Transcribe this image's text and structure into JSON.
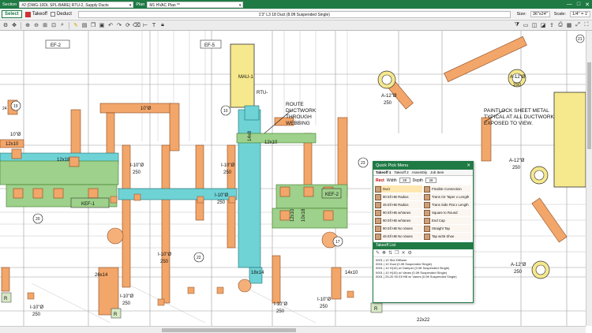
{
  "titlebar": {
    "section_label": "Section",
    "section_value": "#2 (DWG-10DL SPL-BARE) RTU-2, Supply Ducts",
    "plan_label": "Plan",
    "plan_value": "M1   HVAC Plan **",
    "min": "—",
    "max": "□",
    "close": "✕"
  },
  "optbar": {
    "select_label": "Select",
    "takeoff_label": "Takeoff",
    "deduct_label": "Deduct",
    "item_description": "1'3\" L3 18 Duct (8.0ft Suspended Single)",
    "size_label": "Size:",
    "size_value": "36\"x24\"",
    "scale_label": "Scale:",
    "scale_value": "1/4\" = 1'"
  },
  "drawing": {
    "equip": [
      "EF-2",
      "EF-5",
      "MAU-1",
      "RTU-",
      "KEF-1",
      "KEF-2"
    ],
    "numbers": [
      "21",
      "24",
      "10",
      "19",
      "22",
      "23",
      "17",
      "20"
    ],
    "dims": [
      "10\"Ø",
      "12x10",
      "12x18",
      "14x8",
      "12x10",
      "10x18",
      "26x14",
      "18x14",
      "14x10",
      "22x22",
      "12x10",
      "10\"Ø"
    ],
    "cfm": [
      "I-10\"Ø",
      "250",
      "I-10\"Ø",
      "250",
      "I-10\"Ø",
      "250",
      "I-10\"Ø",
      "250",
      "I-10\"Ø",
      "250",
      "I-10\"Ø",
      "250",
      "I-10\"Ø",
      "250",
      "I-10\"Ø",
      "250"
    ],
    "diffusers": [
      "A-12\"Ø",
      "250",
      "A-12\"Ø",
      "250",
      "A-12\"Ø",
      "250",
      "A-12\"Ø",
      "250"
    ],
    "note_route": [
      "ROUTE",
      "DUCTWORK",
      "THROUGH",
      "WEBBING"
    ],
    "note_paint": [
      "PAINTLOCK SHEET METAL",
      "TYPICAL AT ALL DUCTWORK",
      "EXPOSED TO VIEW."
    ],
    "r_label": "R"
  },
  "quick_pick": {
    "title": "Quick Pick Menu",
    "tabs": [
      "Takeoff 1",
      "Takeoff 2",
      "Assembly",
      "Job Item"
    ],
    "shape": "Rect",
    "width_label": "Width",
    "width_value": "28",
    "depth_label": "Depth",
    "depth_value": "28",
    "items": [
      "Duct",
      "Flexible Connection",
      "90 Ell HB Radius",
      "Trans Ctr Taper x Length",
      "45 Ell HB Radius",
      "Trans Side Flat x Length",
      "90 Ell HB w/Vanes",
      "Square to Round",
      "90 Ell HB w/Vanes",
      "End Cap",
      "90 Ell HB No Vanes",
      "Straight Tap",
      "45 Ell HB No Vanes",
      "Tap w/45 Shoe"
    ]
  },
  "takeoff_list": {
    "title": "Takeoff List",
    "rows": [
      "0001 | 10 Slot Diffuser",
      "0001 | 10 Duct (0.0ft Suspended Single)",
      "0001 | 10 H(10) w/ Damper (0.0ft Suspended Single)",
      "0001 | 10 H(10) w/ Vanes (0.0ft Suspended Single)",
      "0001 | 25-20 90 Ell HB w/ Vanes (0.0ft Suspended Single)"
    ]
  },
  "colors": {
    "accent": "#1f7a44",
    "duct_orange": "#f2a66a",
    "duct_teal": "#6fd3d6",
    "duct_green": "#9ed18b",
    "equip_yellow": "#f6e88c"
  }
}
